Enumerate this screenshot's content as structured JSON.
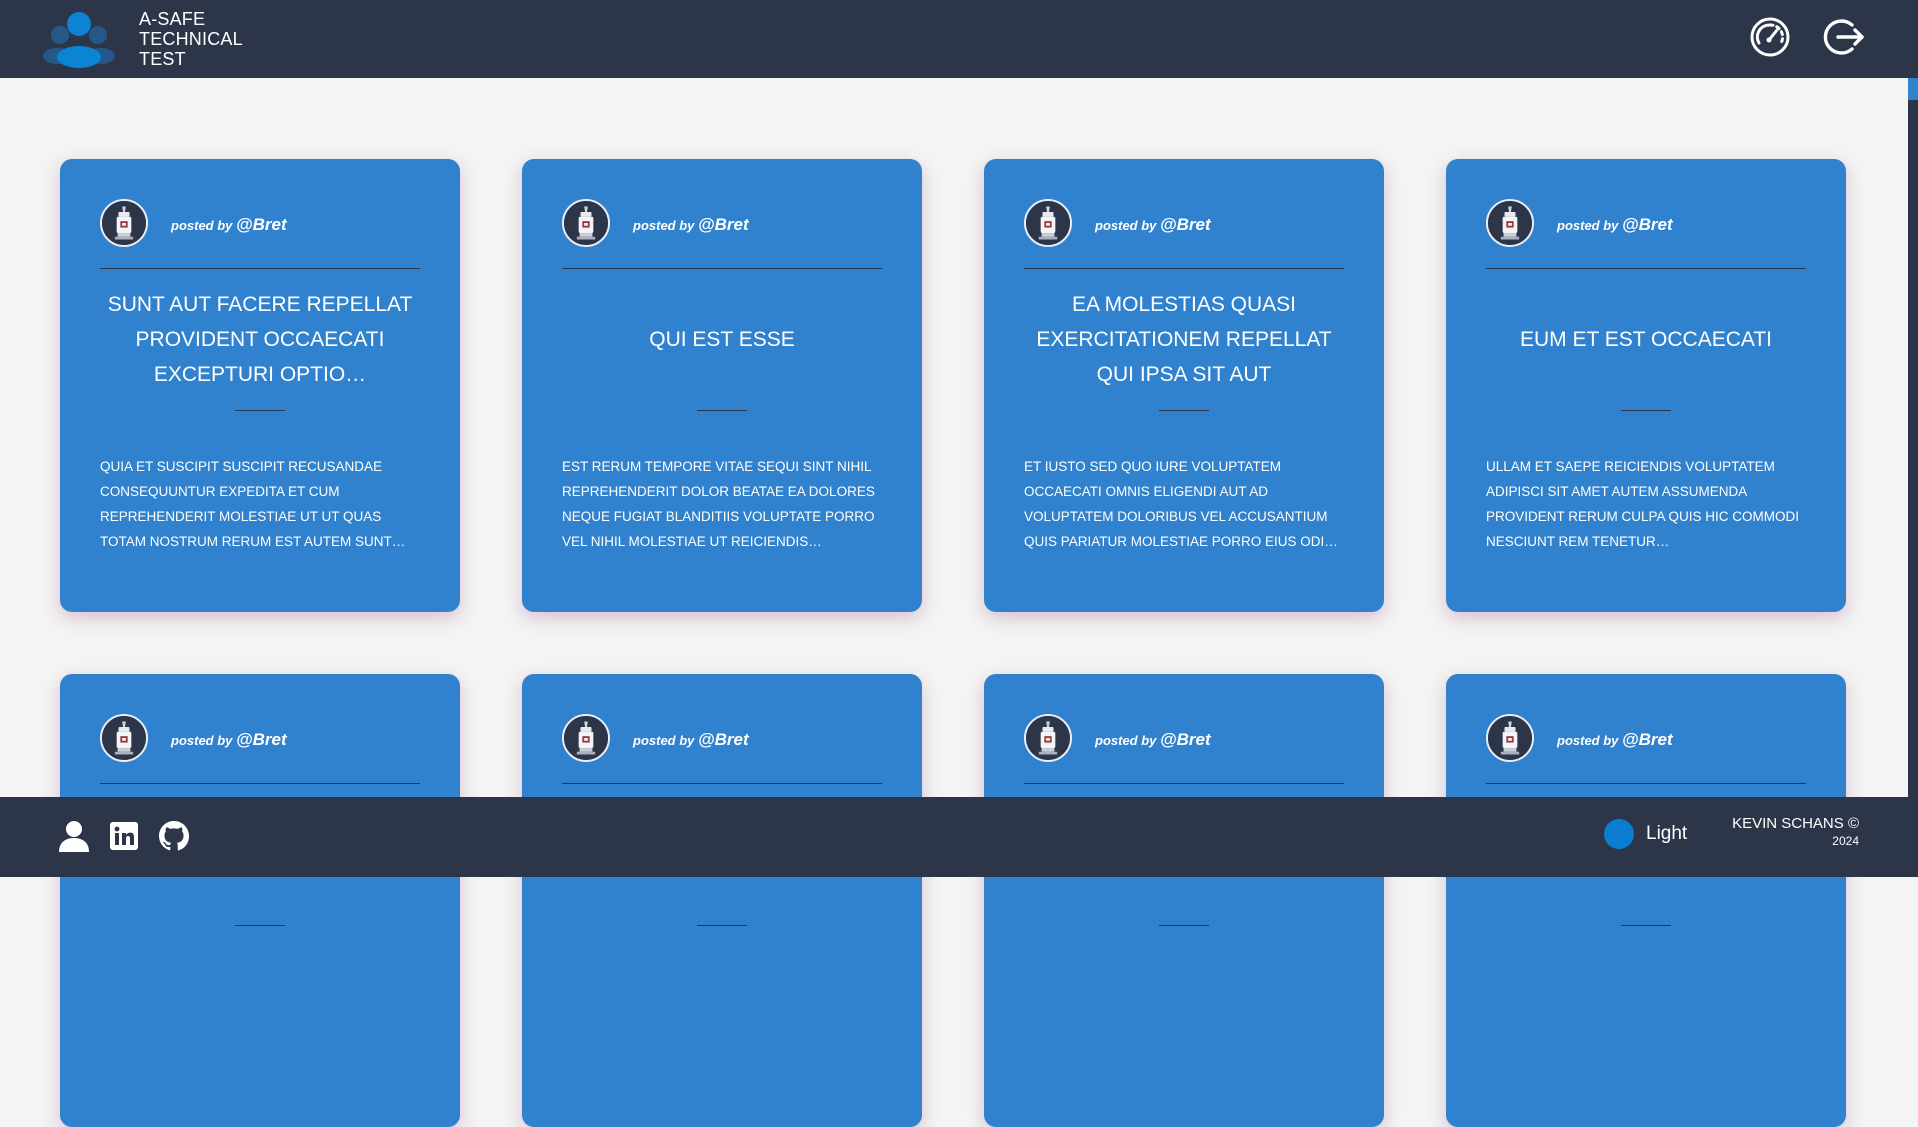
{
  "header": {
    "brand_lines": [
      "A-SAFE",
      "TECHNICAL",
      "TEST"
    ],
    "dashboard_icon": "gauge-icon",
    "logout_icon": "logout-icon"
  },
  "posts": [
    {
      "posted_by": "posted by",
      "user": "@Bret",
      "title": "sunt aut facere repellat provident occaecati excepturi optio…",
      "body": "quia et suscipit suscipit recusandae consequuntur expedita et cum reprehenderit molestiae ut ut quas totam nostrum rerum est autem sunt…"
    },
    {
      "posted_by": "posted by",
      "user": "@Bret",
      "title": "qui est esse",
      "body": "est rerum tempore vitae sequi sint nihil reprehenderit dolor beatae ea dolores neque fugiat blanditiis voluptate porro vel nihil molestiae ut reiciendis…"
    },
    {
      "posted_by": "posted by",
      "user": "@Bret",
      "title": "ea molestias quasi exercitationem repellat qui ipsa sit aut",
      "body": "et iusto sed quo iure voluptatem occaecati omnis eligendi aut ad voluptatem doloribus vel accusantium quis pariatur molestiae porro eius odi…"
    },
    {
      "posted_by": "posted by",
      "user": "@Bret",
      "title": "eum et est occaecati",
      "body": "ullam et saepe reiciendis voluptatem adipisci sit amet autem assumenda provident rerum culpa quis hic commodi nesciunt rem tenetur…"
    },
    {
      "posted_by": "posted by",
      "user": "@Bret",
      "title": "",
      "body": ""
    },
    {
      "posted_by": "posted by",
      "user": "@Bret",
      "title": "",
      "body": ""
    },
    {
      "posted_by": "posted by",
      "user": "@Bret",
      "title": "",
      "body": ""
    },
    {
      "posted_by": "posted by",
      "user": "@Bret",
      "title": "",
      "body": ""
    }
  ],
  "footer": {
    "icons": [
      "user-icon",
      "linkedin-icon",
      "github-icon"
    ],
    "theme_label": "Light",
    "credit_name": "KEVIN SCHANS ©",
    "credit_year": "2024"
  },
  "colors": {
    "header_bg": "#2d3648",
    "card_bg": "#3182ce",
    "page_bg": "#f4f4f4",
    "theme_dot": "#0b7dd0"
  }
}
